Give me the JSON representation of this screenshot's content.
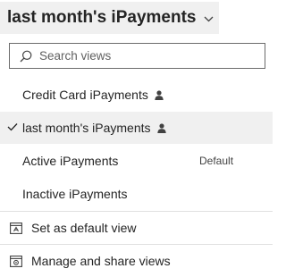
{
  "header": {
    "title": "last month's iPayments"
  },
  "search": {
    "placeholder": "Search views"
  },
  "views": [
    {
      "label": "Credit Card iPayments",
      "personal": true,
      "selected": false,
      "badge": ""
    },
    {
      "label": "last month's iPayments",
      "personal": true,
      "selected": true,
      "badge": ""
    },
    {
      "label": "Active iPayments",
      "personal": false,
      "selected": false,
      "badge": "Default"
    },
    {
      "label": "Inactive iPayments",
      "personal": false,
      "selected": false,
      "badge": ""
    }
  ],
  "actions": {
    "set_default": "Set as default view",
    "manage_share": "Manage and share views"
  },
  "icons": {
    "chevron": "chevron-down-icon",
    "search": "search-icon",
    "check": "checkmark-icon",
    "person": "person-icon",
    "set_default": "default-view-icon",
    "manage": "manage-views-icon"
  },
  "colors": {
    "selected_bg": "#f0f0f0",
    "text": "#242424",
    "divider": "#e0e0e0"
  }
}
